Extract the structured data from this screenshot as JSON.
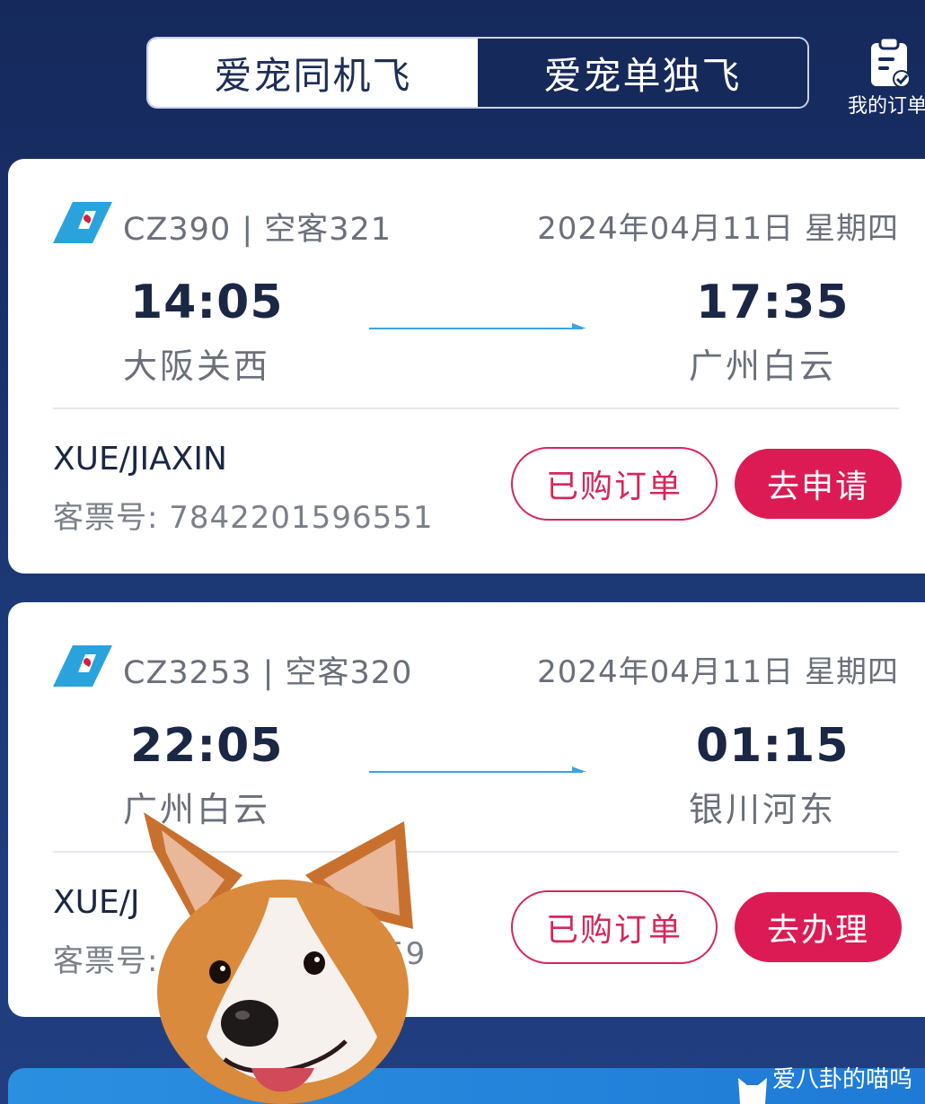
{
  "header": {
    "tabs": [
      {
        "label": "爱宠同机飞",
        "active": true
      },
      {
        "label": "爱宠单独飞",
        "active": false
      }
    ],
    "orders_label": "我的订单",
    "orders_icon": "clipboard-check-icon"
  },
  "colors": {
    "background": "#1c3570",
    "primary_red": "#dc1b54",
    "text_dark": "#1a2745",
    "text_gray": "#6a6f7a",
    "route_blue": "#3aa3e0"
  },
  "flights": [
    {
      "airline_icon": "china-southern-logo",
      "flight_info": "CZ390 | 空客321",
      "date": "2024年04月11日  星期四",
      "dep_time": "14:05",
      "dep_city": "大阪关西",
      "arr_time": "17:35",
      "arr_city": "广州白云",
      "passenger": "XUE/JIAXIN",
      "ticket": "客票号: 7842201596551",
      "btn_outline": "已购订单",
      "btn_solid": "去申请"
    },
    {
      "airline_icon": "china-southern-logo",
      "flight_info": "CZ3253 | 空客320",
      "date": "2024年04月11日  星期四",
      "dep_time": "22:05",
      "dep_city": "广州白云",
      "arr_time": "01:15",
      "arr_city": "银川河东",
      "passenger": "XUE/J",
      "ticket": "客票号:",
      "ticket_tail": "59",
      "btn_outline": "已购订单",
      "btn_solid": "去办理"
    }
  ],
  "overlay": {
    "sticker": "corgi-face-sticker",
    "watermark": "爱八卦的喵呜"
  }
}
